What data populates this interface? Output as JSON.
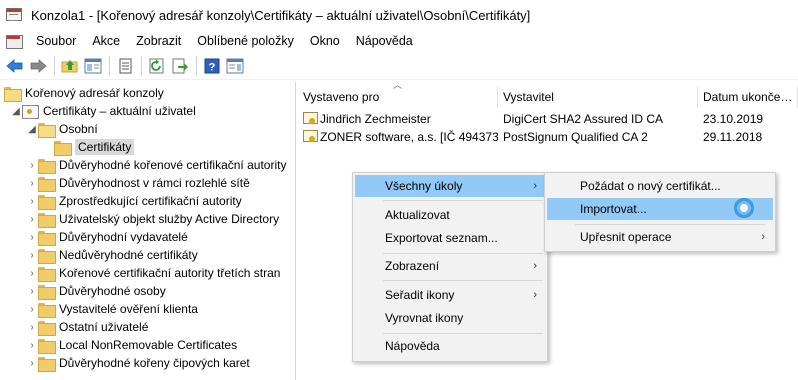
{
  "window": {
    "title": "Konzola1 - [Kořenový adresář konzoly\\Certifikáty – aktuální uživatel\\Osobní\\Certifikáty]"
  },
  "menubar": {
    "items": [
      "Soubor",
      "Akce",
      "Zobrazit",
      "Oblíbené položky",
      "Okno",
      "Nápověda"
    ]
  },
  "toolbar": {
    "buttons": [
      "back-arrow-icon",
      "forward-arrow-icon",
      "up-folder-icon",
      "show-hide-tree-icon",
      "properties-icon",
      "refresh-icon",
      "export-list-icon",
      "help-icon",
      "show-hide-action-pane-icon"
    ]
  },
  "tree": {
    "root": "Kořenový adresář konzoly",
    "store": "Certifikáty – aktuální uživatel",
    "personal": "Osobní",
    "certificates": "Certifikáty",
    "folders": [
      "Důvěryhodné kořenové certifikační autority",
      "Důvěryhodnost v rámci rozlehlé sítě",
      "Zprostředkující certifikační autority",
      "Uživatelský objekt služby Active Directory",
      "Důvěryhodní vydavatelé",
      "Nedůvěryhodné certifikáty",
      "Kořenové certifikační autority třetích stran",
      "Důvěryhodné osoby",
      "Vystavitelé ověření klienta",
      "Ostatní uživatelé",
      "Local NonRemovable Certificates",
      "Důvěryhodné kořeny čipových karet"
    ]
  },
  "list": {
    "columns": [
      "Vystaveno pro",
      "Vystavitel",
      "Datum ukonče…"
    ],
    "rows": [
      {
        "issued_to": "Jindřich Zechmeister",
        "issuer": "DigiCert SHA2 Assured ID CA",
        "expires": "23.10.2019"
      },
      {
        "issued_to": "ZONER software, a.s. [IČ 494373…",
        "issuer": "PostSignum Qualified CA 2",
        "expires": "29.11.2018"
      }
    ]
  },
  "context_menu": {
    "all_tasks": "Všechny úkoly",
    "refresh": "Aktualizovat",
    "export_list": "Exportovat seznam...",
    "view": "Zobrazení",
    "arrange_icons": "Seřadit ikony",
    "line_up_icons": "Vyrovnat ikony",
    "help": "Nápověda"
  },
  "submenu": {
    "request_new": "Požádat o nový certifikát...",
    "import": "Importovat...",
    "advanced": "Upřesnit operace"
  },
  "colors": {
    "highlight": "#91c9f7",
    "menu_bg": "#f2f2f2",
    "folder": "#f0cd6a"
  }
}
